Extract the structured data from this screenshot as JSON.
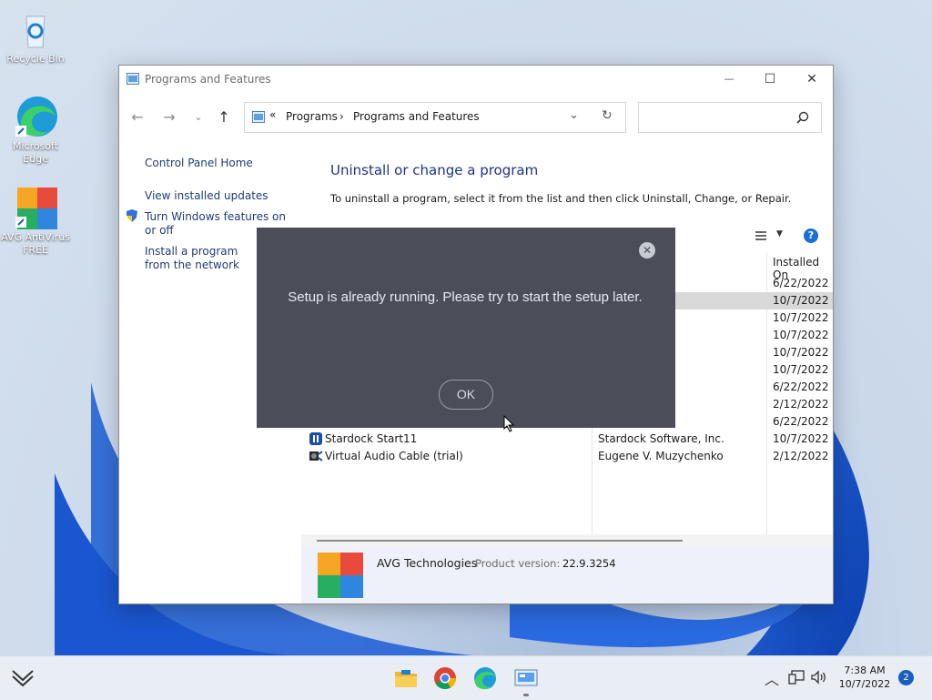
{
  "desktop": {
    "icons": [
      {
        "label": "Recycle Bin"
      },
      {
        "label": "Microsoft Edge"
      },
      {
        "label": "AVG AntiVirus FREE"
      }
    ]
  },
  "window": {
    "title": "Programs and Features",
    "controls": {
      "minimize": "—",
      "maximize": "☐",
      "close": "✕"
    },
    "address": {
      "sep": "«",
      "crumbs": [
        "Programs",
        "Programs and Features"
      ],
      "arrow": "›"
    },
    "search_placeholder": ""
  },
  "sidebar": {
    "items": [
      {
        "label": "Control Panel Home"
      },
      {
        "label": "View installed updates"
      },
      {
        "label": "Turn Windows features on or off"
      },
      {
        "label": "Install a program from the network"
      }
    ]
  },
  "main": {
    "title": "Uninstall or change a program",
    "description": "To uninstall a program, select it from the list and then click Uninstall, Change, or Repair.",
    "column_installed_on": "Installed On",
    "rows": [
      {
        "name": "",
        "publisher": "",
        "date": "6/22/2022"
      },
      {
        "name": "",
        "publisher": "es",
        "date": "10/7/2022"
      },
      {
        "name": "",
        "publisher": "",
        "date": "10/7/2022"
      },
      {
        "name": "",
        "publisher": "ration",
        "date": "10/7/2022"
      },
      {
        "name": "",
        "publisher": "ration",
        "date": "10/7/2022"
      },
      {
        "name": "",
        "publisher": "ration",
        "date": "10/7/2022"
      },
      {
        "name": "",
        "publisher": "",
        "date": "6/22/2022"
      },
      {
        "name": "",
        "publisher": "",
        "date": "2/12/2022"
      },
      {
        "name": "",
        "publisher": "m",
        "date": "6/22/2022"
      },
      {
        "name": "Stardock Start11",
        "publisher": "Stardock Software, Inc.",
        "date": "10/7/2022"
      },
      {
        "name": "Virtual Audio Cable (trial)",
        "publisher": "Eugene V. Muzychenko",
        "date": "2/12/2022"
      }
    ]
  },
  "details": {
    "publisher": "AVG Technologies",
    "version_label": "Product version:",
    "version": "22.9.3254"
  },
  "dialog": {
    "message": "Setup is already running. Please try to start the setup later.",
    "ok_label": "OK",
    "close_glyph": "✕"
  },
  "taskbar": {
    "time": "7:38 AM",
    "date": "10/7/2022",
    "notifications": "2"
  }
}
